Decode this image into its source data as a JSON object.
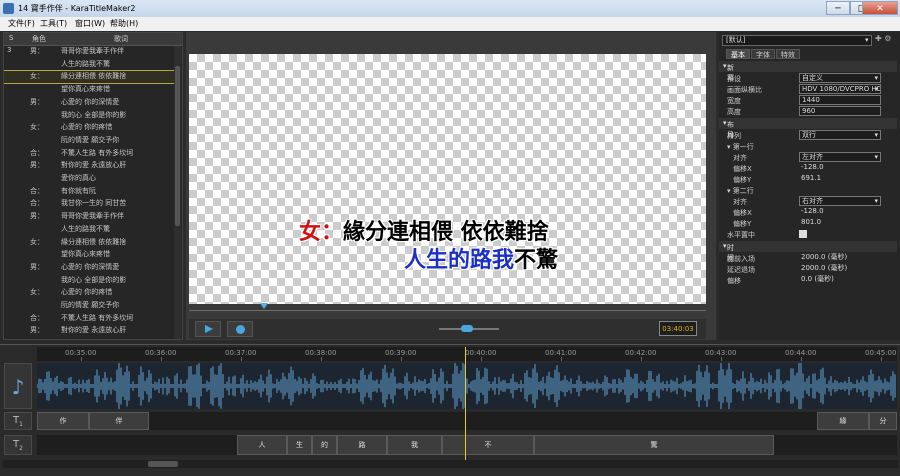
{
  "window": {
    "title": "14 寶手作伴 - KaraTitleMaker2",
    "controls": [
      "─",
      "□",
      "✕"
    ]
  },
  "menu": [
    "文件(F)",
    "工具(T)",
    "窗口(W)",
    "帮助(H)"
  ],
  "lyrics_panel": {
    "headers": [
      "S",
      "角色",
      "歌词"
    ],
    "rows": [
      {
        "n": "3",
        "role": "男：",
        "text": "哥哥你愛我牽手作伴",
        "selected": false
      },
      {
        "n": "",
        "role": "",
        "text": "人生的路我不驚",
        "selected": false
      },
      {
        "n": "",
        "role": "女：",
        "text": "緣分連相偎 依依難捨",
        "selected": true
      },
      {
        "n": "",
        "role": "",
        "text": "望你真心來疼惜",
        "selected": false
      },
      {
        "n": "",
        "role": "男：",
        "text": "心愛的 你的深情愛",
        "selected": false
      },
      {
        "n": "",
        "role": "",
        "text": "我的心 全部是你的影",
        "selected": false
      },
      {
        "n": "",
        "role": "女：",
        "text": "心愛的 你的疼惜",
        "selected": false
      },
      {
        "n": "",
        "role": "",
        "text": "阮的情愛 願交予你",
        "selected": false
      },
      {
        "n": "",
        "role": "合：",
        "text": "不驚人生路 有外多坎坷",
        "selected": false
      },
      {
        "n": "",
        "role": "男：",
        "text": "對你的愛 永遠放心肝",
        "selected": false
      },
      {
        "n": "",
        "role": "",
        "text": "愛你的真心",
        "selected": false
      },
      {
        "n": "",
        "role": "合：",
        "text": "有你就有阮",
        "selected": false
      },
      {
        "n": "",
        "role": "合：",
        "text": "我甘你一生的 同甘苦",
        "selected": false
      },
      {
        "n": "",
        "role": "男：",
        "text": "哥哥你愛我牽手作伴",
        "selected": false
      },
      {
        "n": "",
        "role": "",
        "text": "人生的路我不驚",
        "selected": false
      },
      {
        "n": "",
        "role": "女：",
        "text": "緣分連相偎 依依難捨",
        "selected": false
      },
      {
        "n": "",
        "role": "",
        "text": "望你真心來疼惜",
        "selected": false
      },
      {
        "n": "",
        "role": "男：",
        "text": "心愛的 你的深情愛",
        "selected": false
      },
      {
        "n": "",
        "role": "",
        "text": "我的心 全部是你的影",
        "selected": false
      },
      {
        "n": "",
        "role": "女：",
        "text": "心愛的 你的疼惜",
        "selected": false
      },
      {
        "n": "",
        "role": "",
        "text": "阮的情愛 願交予你",
        "selected": false
      },
      {
        "n": "",
        "role": "合：",
        "text": "不驚人生路 有外多坎坷",
        "selected": false
      },
      {
        "n": "",
        "role": "男：",
        "text": "對你的愛 永遠放心肝",
        "selected": false
      }
    ]
  },
  "preview": {
    "line1_role": "女：",
    "line1_text": "緣分連相偎 依依難捨",
    "line2_sung": "人生的路我",
    "line2_unsung": "不驚",
    "timecode": "03:40:03"
  },
  "properties": {
    "preset": "[默认]",
    "tabs": [
      "基本",
      "字体",
      "特效"
    ],
    "sections": {
      "new": "新幕",
      "layout": "布局",
      "line1": "第一行",
      "line2": "第二行",
      "time": "时间"
    },
    "fields": {
      "preset_label": "预设",
      "preset_value": "自定义",
      "ratio_label": "画面纵横比",
      "ratio_value": "HDV 1080/DVCPRO HD",
      "width_label": "宽度",
      "width_value": "1440",
      "height_label": "高度",
      "height_value": "960",
      "arrange_label": "排列",
      "arrange_value": "双行",
      "l1_align_label": "对齐",
      "l1_align_value": "左对齐",
      "l1_x_label": "偏移X",
      "l1_x_value": "-128.0",
      "l1_y_label": "偏移Y",
      "l1_y_value": "691.1",
      "l2_align_label": "对齐",
      "l2_align_value": "右对齐",
      "l2_x_label": "偏移X",
      "l2_x_value": "-128.0",
      "l2_y_label": "偏移Y",
      "l2_y_value": "801.0",
      "center_label": "水平置中",
      "fadein_label": "提前入场",
      "fadein_value": "2000.0 (毫秒)",
      "fadeout_label": "延迟退场",
      "fadeout_value": "2000.0 (毫秒)",
      "offset_label": "偏移",
      "offset_value": "0.0 (毫秒)"
    }
  },
  "timeline": {
    "ticks": [
      "00:35:00",
      "00:36:00",
      "00:37:00",
      "00:38:00",
      "00:39:00",
      "00:40:00",
      "00:41:00",
      "00:42:00",
      "00:43:00",
      "00:44:00",
      "00:45:00"
    ],
    "track1_blocks": [
      "作",
      "伴",
      "緣",
      "分"
    ],
    "track2_blocks": [
      "人",
      "生",
      "的",
      "路",
      "我",
      "不",
      "驚"
    ],
    "icons": [
      "music-note-icon",
      "text-track-1-icon",
      "text-track-2-icon"
    ]
  }
}
